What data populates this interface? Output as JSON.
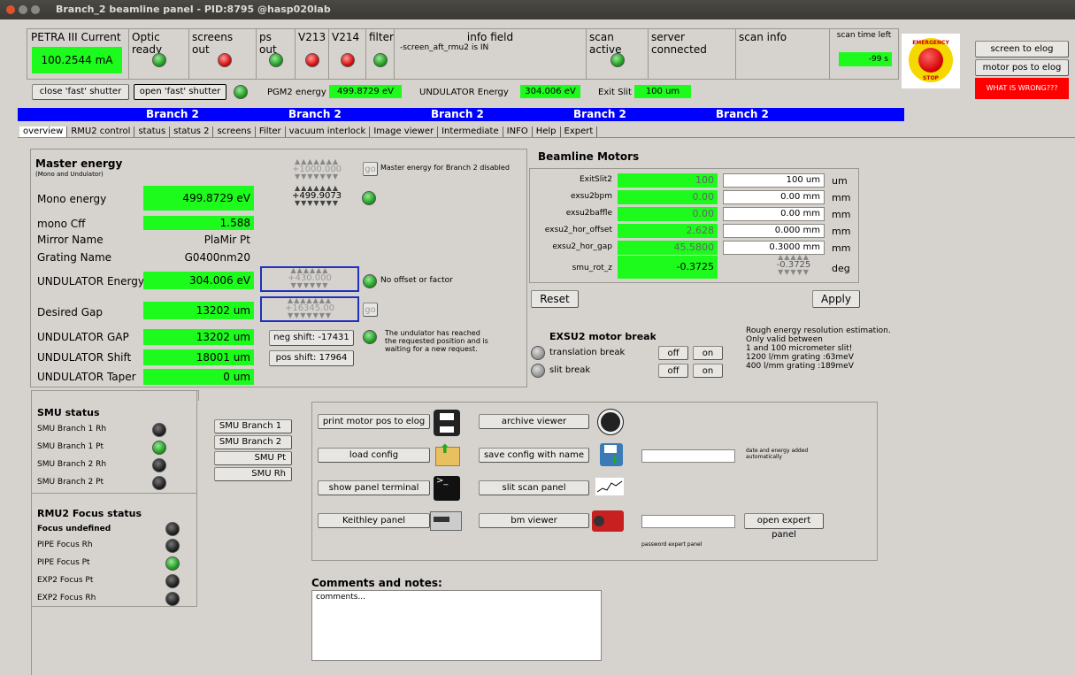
{
  "window": {
    "title": "Branch_2 beamline panel - PID:8795 @hasp020lab"
  },
  "header": {
    "petra_label": "PETRA III Current",
    "petra_value": "100.2544 mA",
    "optic_ready": "Optic ready",
    "screens_out": "screens out",
    "ps_out": "ps out",
    "v213": "V213",
    "v214": "V214",
    "filter": "filter",
    "info_field": "info field",
    "info_text": "-screen_aft_rmu2 is IN",
    "scan_active": "scan active",
    "server_connected": "server connected",
    "scan_info": "scan info",
    "scan_time_left": "scan time left",
    "scan_time_value": "-99 s",
    "emergency_top": "EMERGENCY",
    "emergency_bottom": "STOP"
  },
  "right_buttons": {
    "screen_to_elog": "screen to elog",
    "motor_pos_to_elog": "motor pos to elog",
    "what_is_wrong": "WHAT IS WRONG???"
  },
  "shutter_row": {
    "close": "close 'fast' shutter",
    "open": "open 'fast' shutter",
    "pgm2_label": "PGM2 energy",
    "pgm2_value": "499.8729 eV",
    "und_label": "UNDULATOR Energy",
    "und_value": "304.006 eV",
    "exit_label": "Exit Slit",
    "exit_value": "100 um"
  },
  "branch_banner": [
    "Branch 2",
    "Branch 2",
    "Branch 2",
    "Branch 2",
    "Branch 2"
  ],
  "tabs": [
    "overview",
    "RMU2 control",
    "status",
    "status 2",
    "screens",
    "Filter",
    "vacuum interlock",
    "Image viewer",
    "Intermediate",
    "INFO",
    "Help",
    "Expert"
  ],
  "master": {
    "title": "Master energy",
    "subtitle": "(Mono and Undulator)",
    "setpoint_digits": "+1000.000",
    "go": "go",
    "disabled_text": "Master energy for Branch 2 disabled",
    "mono_label": "Mono energy",
    "mono_value": "499.8729 eV",
    "mono_digits": "+499.9073",
    "cff_label": "mono Cff",
    "cff_value": "1.588",
    "mirror_label": "Mirror Name",
    "mirror_value": "PlaMir Pt",
    "grating_label": "Grating Name",
    "grating_value": "G0400nm20",
    "und_label": "UNDULATOR Energy",
    "und_value": "304.006 eV",
    "und_digits": "+430.000",
    "offset_text": "No offset or factor",
    "gap_label": "Desired Gap",
    "gap_value": "13202 um",
    "gap_digits": "+16345.00",
    "ugap_label": "UNDULATOR GAP",
    "ugap_value": "13202 um",
    "neg_shift": "neg shift: -17431",
    "reached_text": "The undulator has reached the requested position and is waiting for a new request.",
    "shift_label": "UNDULATOR Shift",
    "shift_value": "18001 um",
    "pos_shift": "pos shift: 17964",
    "taper_label": "UNDULATOR Taper",
    "taper_value": "0 um"
  },
  "motors": {
    "title": "Beamline Motors",
    "rows": [
      {
        "name": "ExitSlit2",
        "value": "100",
        "set": "100 um",
        "unit": "um"
      },
      {
        "name": "exsu2bpm",
        "value": "0.00",
        "set": "0.00 mm",
        "unit": "mm"
      },
      {
        "name": "exsu2baffle",
        "value": "0.00",
        "set": "0.00 mm",
        "unit": "mm"
      },
      {
        "name": "exsu2_hor_offset",
        "value": "2.628",
        "set": "0.000 mm",
        "unit": "mm"
      },
      {
        "name": "exsu2_hor_gap",
        "value": "45.5800",
        "set": "0.3000 mm",
        "unit": "mm"
      }
    ],
    "smu_label": "smu_rot_z",
    "smu_value": "-0.3725",
    "smu_digits": "-0.3725",
    "smu_unit": "deg",
    "reset": "Reset",
    "apply": "Apply"
  },
  "breaks": {
    "title": "EXSU2 motor breaks",
    "translation": "translation break",
    "slit": "slit break",
    "off": "off",
    "on": "on"
  },
  "resolution": {
    "lines": [
      "Rough energy resolution estimation.",
      "Only valid between",
      "1 and 100 micrometer slit!",
      "1200 l/mm grating :63meV",
      "400 l/mm grating :189meV"
    ]
  },
  "smu": {
    "title": "SMU status",
    "items": [
      "SMU Branch 1 Rh",
      "SMU Branch 1 Pt",
      "SMU Branch 2 Rh",
      "SMU Branch 2 Pt"
    ],
    "leds": [
      "black",
      "green",
      "black",
      "black"
    ],
    "buttons": [
      "SMU Branch 1",
      "SMU Branch 2",
      "SMU Pt",
      "SMU Rh"
    ]
  },
  "focus": {
    "title": "RMU2 Focus status",
    "undefined": "Focus undefined",
    "items": [
      "PIPE Focus Rh",
      "PIPE Focus Pt",
      "EXP2 Focus Pt",
      "EXP2 Focus Rh"
    ],
    "leds": [
      "black",
      "black",
      "green",
      "black",
      "black"
    ]
  },
  "tools": {
    "print": "print motor pos to elog",
    "archive": "archive viewer",
    "load": "load config",
    "save": "save config with name",
    "save_note": "date and energy added automatically",
    "terminal": "show panel terminal",
    "slit_scan": "slit scan panel",
    "keithley": "Keithley panel",
    "bm": "bm viewer",
    "expert": "open expert panel",
    "password": "password expert panel"
  },
  "comments": {
    "title": "Comments and notes:",
    "text": "comments..."
  },
  "colors": {
    "green": "#1dfb1d",
    "blue": "#0000ff",
    "red": "#ff0000"
  }
}
